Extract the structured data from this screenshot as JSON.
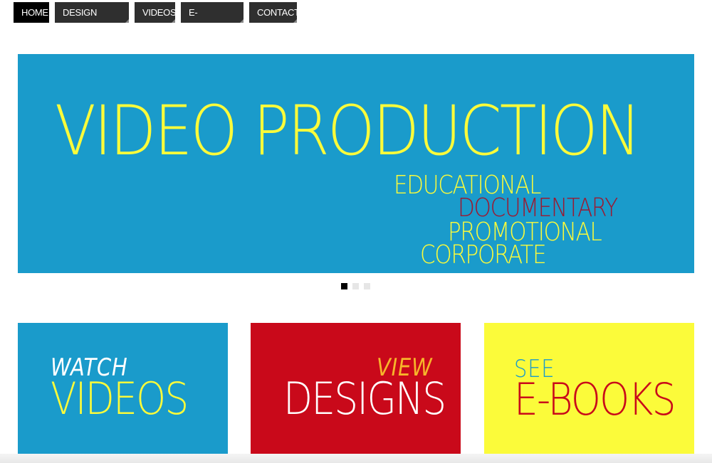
{
  "nav": {
    "items": [
      {
        "label": "HOME"
      },
      {
        "label": "DESIGN SAMPLES"
      },
      {
        "label": "VIDEOS"
      },
      {
        "label": "E-PUBLISHING"
      },
      {
        "label": "CONTACT"
      }
    ]
  },
  "slider": {
    "title": "VIDEO PRODUCTION",
    "subtitles": [
      "EDUCATIONAL",
      "DOCUMENTARY",
      "PROMOTIONAL",
      "CORPORATE"
    ],
    "active_slide": 1,
    "slide_count": 3
  },
  "tiles": [
    {
      "small": "WATCH",
      "big": "VIDEOS"
    },
    {
      "small": "VIEW",
      "big": "DESIGNS"
    },
    {
      "small": "SEE",
      "big": "E-BOOKS"
    }
  ],
  "colors": {
    "blue": "#1a9bcb",
    "red": "#c9091a",
    "yellow": "#fbfb3a",
    "dark_red": "#9b1a32",
    "white": "#ffffff",
    "nav_bg": "#2f2f2f",
    "nav_active": "#000000"
  }
}
